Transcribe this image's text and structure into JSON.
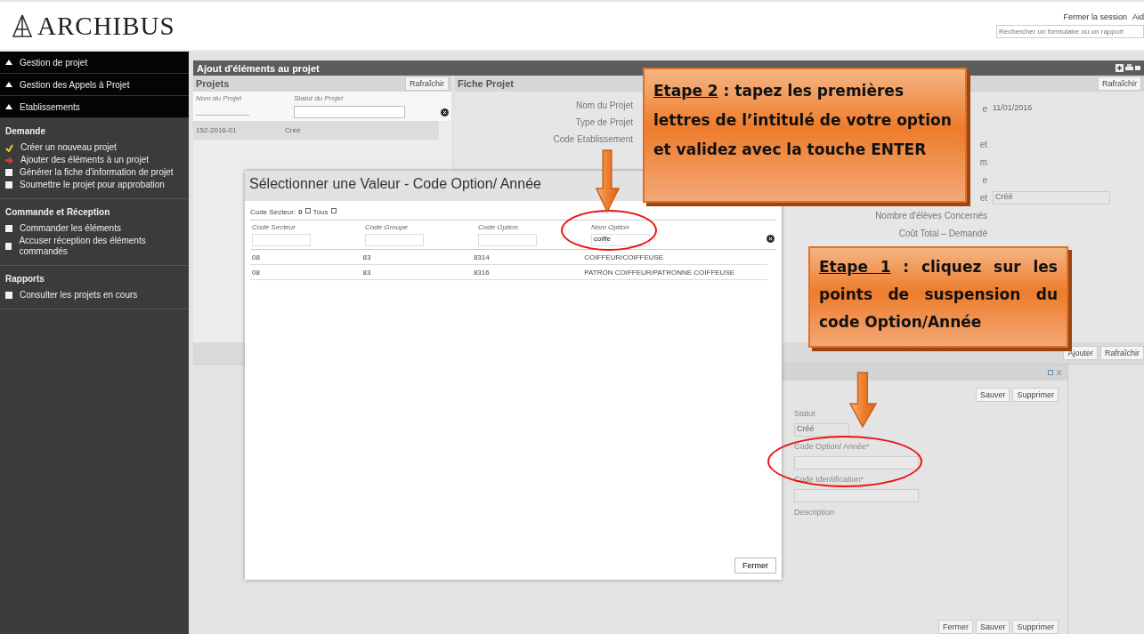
{
  "header": {
    "logo": "ARCHIBUS",
    "links": [
      "Fermer la session",
      "Aid"
    ],
    "search": {
      "placeholder": "Rechercher un formulaire ou un rapport"
    }
  },
  "sidebar": {
    "groups": [
      "Gestion de projet",
      "Gestion des Appels à Projet",
      "Etablissements"
    ],
    "sections": [
      {
        "title": "Demande",
        "items": [
          {
            "label": "Créer un nouveau projet",
            "kind": "check"
          },
          {
            "label": "Ajouter des éléments à un projet",
            "kind": "arrow"
          },
          {
            "label": "Générer la fiche d'information de projet",
            "kind": "square"
          },
          {
            "label": "Soumettre le projet pour approbation",
            "kind": "square"
          }
        ]
      },
      {
        "title": "Commande et Réception",
        "items": [
          {
            "label": "Commander les éléments",
            "kind": "square"
          },
          {
            "label": "Accuser réception des éléments commandés",
            "kind": "square"
          }
        ]
      },
      {
        "title": "Rapports",
        "items": [
          {
            "label": "Consulter les projets en cours",
            "kind": "square"
          }
        ]
      }
    ]
  },
  "main": {
    "title": "Ajout d'éléments au projet",
    "projects_panel": {
      "title": "Projets",
      "refresh": "Rafraîchir",
      "columns": [
        "Nom du Projet",
        "Statut du Projet"
      ],
      "rows": [
        [
          "152-2016-01",
          "Créé"
        ]
      ]
    },
    "project_form": {
      "title": "Fiche Projet",
      "refresh": "Rafraîchir",
      "left_fields": [
        {
          "label": "Nom du Projet"
        },
        {
          "label": "Type de Projet"
        },
        {
          "label": "Code Etablissement"
        }
      ],
      "right_fields": [
        {
          "label": "e",
          "kind": "text",
          "value": "11/01/2016"
        },
        {
          "label": "et",
          "kind": "text"
        },
        {
          "label": "m",
          "kind": "none"
        },
        {
          "label": "e",
          "kind": "text"
        },
        {
          "label": "et",
          "kind": "select",
          "value": "Créé"
        },
        {
          "label": "Nombre d'élèves Concernés",
          "kind": "text"
        },
        {
          "label": "Coût Total – Demandé",
          "kind": "text"
        }
      ]
    },
    "actions": [
      "Ajouter",
      "Rafraîchir"
    ],
    "element_form": {
      "top_buttons": [
        "Sauver",
        "Supprimer"
      ],
      "fields": [
        {
          "label": "Statut",
          "kind": "select",
          "value": "Créé"
        },
        {
          "label": "Code Option/ Année*",
          "kind": "text"
        },
        {
          "label": "Code Identification*",
          "kind": "text"
        },
        {
          "label": "Description",
          "kind": "none"
        }
      ],
      "bottom_buttons": [
        "Fermer",
        "Sauver",
        "Supprimer"
      ]
    }
  },
  "dialog": {
    "title": "Sélectionner une Valeur - Code Option/ Année",
    "filter": {
      "label": "Code Secteur:",
      "value": "0",
      "all": "Tous"
    },
    "columns": [
      {
        "label": "Code Secteur"
      },
      {
        "label": "Code Groupe"
      },
      {
        "label": "Code Option"
      },
      {
        "label": "Nom Option",
        "filter": "coiffe"
      }
    ],
    "rows": [
      [
        "08",
        "83",
        "8314",
        "COIFFEUR/COIFFEUSE"
      ],
      [
        "08",
        "83",
        "8316",
        "PATRON COIFFEUR/PATRONNE COIFFEUSE"
      ]
    ],
    "close": "Fermer"
  },
  "callouts": [
    {
      "step": "Etape 2",
      "text": " : tapez les premières lettres de l’intitulé de votre option et validez avec la touche ENTER"
    },
    {
      "step": "Etape 1",
      "text": " : cliquez sur les points de suspension du code Option/Année"
    }
  ]
}
